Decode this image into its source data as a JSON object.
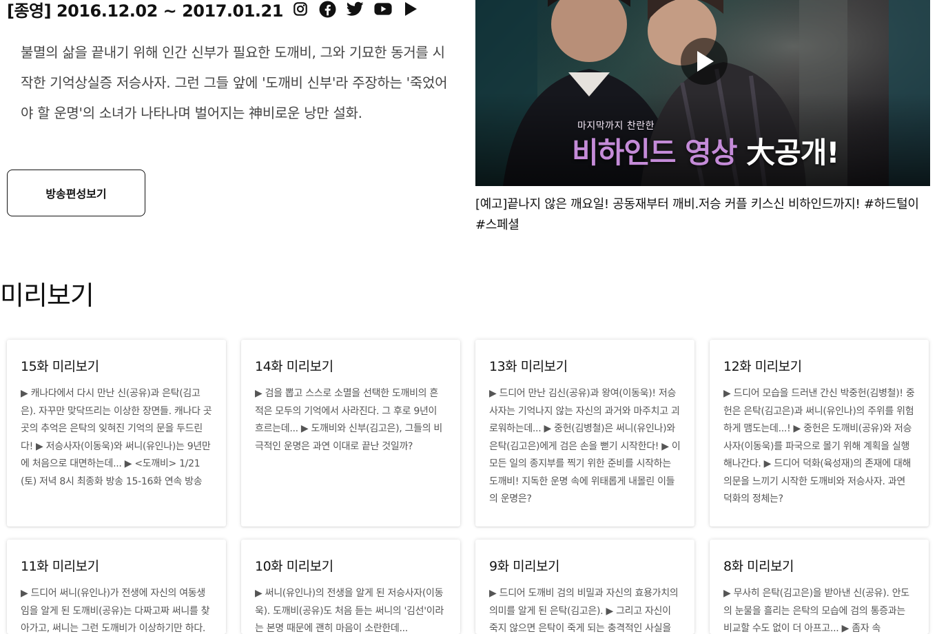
{
  "header": {
    "air_text": "[종영] 2016.12.02 ~ 2017.01.21",
    "social_icons": [
      "instagram-icon",
      "facebook-icon",
      "twitter-icon",
      "youtube-icon",
      "play-store-icon"
    ]
  },
  "intro": {
    "description": "불멸의 삶을 끝내기 위해 인간 신부가 필요한 도깨비, 그와 기묘한 동거를 시작한 기억상실증 저승사자. 그런 그들 앞에 '도깨비 신부'라 주장하는 '죽었어야 할 운명'의 소녀가 나타나며 벌어지는 神비로운 낭만 설화.",
    "schedule_button": "방송편성보기"
  },
  "featured_video": {
    "overlay_small": "마지막까지 찬란한",
    "overlay_purple": "비하인드 영상",
    "overlay_white": "大공개!",
    "caption": "[예고]끝나지 않은 깨요일! 공동재부터 깨비.저승 커플 키스신 비하인드까지! #하드털이 #스페셜"
  },
  "preview": {
    "section_title": "미리보기",
    "cards": [
      {
        "title": "15화 미리보기",
        "body": "▶ 캐나다에서 다시 만난 신(공유)과 은탁(김고은). 자꾸만 맞닥뜨리는 이상한 장면들. 캐나다 곳곳의 추억은 은탁의 잊혀진 기억의 문을 두드린다! ▶ 저승사자(이동욱)와 써니(유인나)는 9년만에 처음으로 대면하는데... ▶ <도깨비> 1/21 (토) 저녁 8시 최종화 방송 15-16화 연속 방송"
      },
      {
        "title": "14화 미리보기",
        "body": "▶ 검을 뽑고 스스로 소멸을 선택한 도깨비의 흔적은 모두의 기억에서 사라진다. 그 후로 9년이 흐르는데... ▶ 도깨비와 신부(김고은), 그들의 비극적인 운명은 과연 이대로 끝난 것일까?"
      },
      {
        "title": "13화 미리보기",
        "body": "▶ 드디어 만난 김신(공유)과 왕여(이동욱)! 저승사자는 기억나지 않는 자신의 과거와 마주치고 괴로워하는데... ▶ 중헌(김병철)은 써니(유인나)와 은탁(김고은)에게 검은 손을 뻗기 시작한다! ▶ 이 모든 일의 종지부를 찍기 위한 준비를 시작하는 도깨비! 지독한 운명 속에 위태롭게 내몰린 이들의 운명은?"
      },
      {
        "title": "12화 미리보기",
        "body": "▶ 드디어 모습을 드러낸 간신 박중헌(김병철)! 중헌은 은탁(김고은)과 써니(유인나)의 주위를 위험하게 맴도는데...! ▶ 중헌은 도깨비(공유)와 저승사자(이동욱)를 파국으로 몰기 위해 계획을 실행해나간다. ▶ 드디어 덕화(육성재)의 존재에 대해 의문을 느끼기 시작한 도깨비와 저승사자. 과연 덕화의 정체는?"
      },
      {
        "title": "11화 미리보기",
        "body": "▶ 드디어 써니(유인나)가 전생에 자신의 여동생임을 알게 된 도깨비(공유)는 다짜고짜 써니를 찾아가고, 써니는 그런 도깨비가 이상하기만 하다."
      },
      {
        "title": "10화 미리보기",
        "body": "▶ 써니(유인나)의 전생을 알게 된 저승사자(이동욱). 도깨비(공유)도 처음 듣는 써니의 '김선'이라는 본명 때문에 괜히 마음이 소란한데..."
      },
      {
        "title": "9화 미리보기",
        "body": "▶ 드디어 도깨비 검의 비밀과 자신의 효용가치의 의미를 알게 된 은탁(김고은). ▶ 그리고 자신이 죽지 않으면 은탁이 죽게 되는 충격적인 사실을 알게 된다."
      },
      {
        "title": "8화 미리보기",
        "body": "▶ 무사히 은탁(김고은)을 받아낸 신(공유). 안도의 눈물을 흘리는 은탁의 모습에 검의 통증과는 비교할 수도 없이 더 아프고... ▶ 좀자 속"
      }
    ]
  }
}
